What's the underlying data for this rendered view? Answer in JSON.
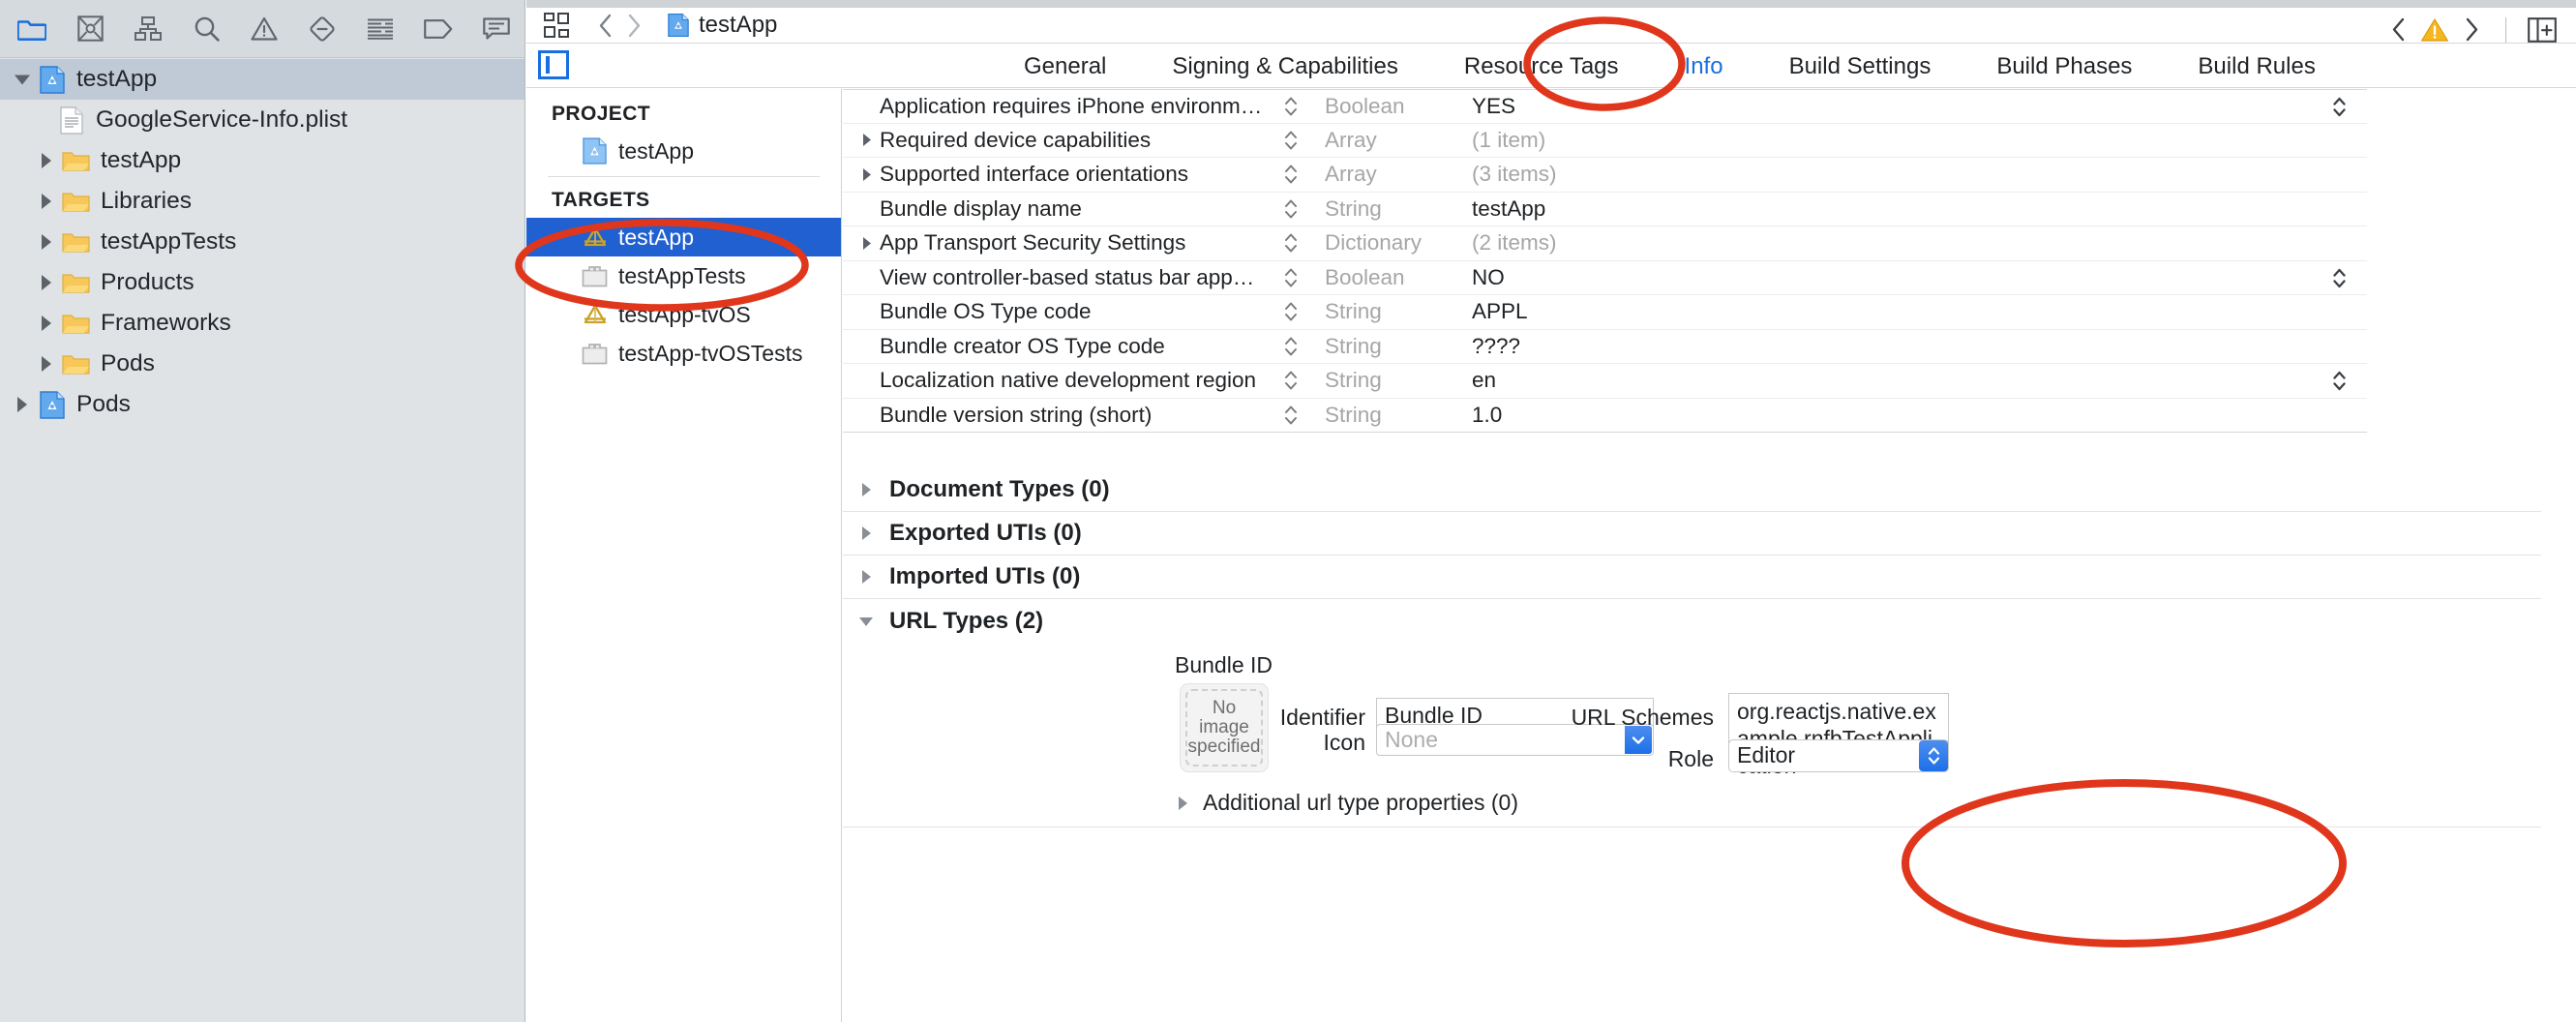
{
  "navigator": {
    "toolbar_icons": [
      {
        "name": "folder-icon",
        "label": "Project navigator",
        "active": true
      },
      {
        "name": "source-control-icon",
        "label": "Source control navigator",
        "active": false
      },
      {
        "name": "hierarchy-icon",
        "label": "Symbol navigator",
        "active": false
      },
      {
        "name": "search-icon",
        "label": "Find navigator",
        "active": false
      },
      {
        "name": "warning-triangle-icon",
        "label": "Issue navigator",
        "active": false
      },
      {
        "name": "test-diamond-icon",
        "label": "Test navigator",
        "active": false
      },
      {
        "name": "debug-list-icon",
        "label": "Debug navigator",
        "active": false
      },
      {
        "name": "breakpoint-tag-icon",
        "label": "Breakpoint navigator",
        "active": false
      },
      {
        "name": "report-bubble-icon",
        "label": "Report navigator",
        "active": false
      }
    ],
    "tree": [
      {
        "label": "testApp",
        "icon": "xcode-project-icon",
        "depth": 0,
        "twisty": "down",
        "selected": true
      },
      {
        "label": "GoogleService-Info.plist",
        "icon": "plist-file-icon",
        "depth": 1,
        "twisty": "none",
        "selected": false
      },
      {
        "label": "testApp",
        "icon": "folder-icon",
        "depth": 1,
        "twisty": "right",
        "selected": false
      },
      {
        "label": "Libraries",
        "icon": "folder-icon",
        "depth": 1,
        "twisty": "right",
        "selected": false
      },
      {
        "label": "testAppTests",
        "icon": "folder-icon",
        "depth": 1,
        "twisty": "right",
        "selected": false
      },
      {
        "label": "Products",
        "icon": "folder-icon",
        "depth": 1,
        "twisty": "right",
        "selected": false
      },
      {
        "label": "Frameworks",
        "icon": "folder-icon",
        "depth": 1,
        "twisty": "right",
        "selected": false
      },
      {
        "label": "Pods",
        "icon": "folder-icon",
        "depth": 1,
        "twisty": "right",
        "selected": false
      },
      {
        "label": "Pods",
        "icon": "xcode-project-icon",
        "depth": 0,
        "twisty": "right",
        "selected": false
      }
    ]
  },
  "editor_toolbar": {
    "breadcrumb_title": "testApp",
    "back_label": "‹",
    "forward_label": "›"
  },
  "tabs": [
    {
      "label": "General",
      "active": false
    },
    {
      "label": "Signing & Capabilities",
      "active": false
    },
    {
      "label": "Resource Tags",
      "active": false
    },
    {
      "label": "Info",
      "active": true
    },
    {
      "label": "Build Settings",
      "active": false
    },
    {
      "label": "Build Phases",
      "active": false
    },
    {
      "label": "Build Rules",
      "active": false
    }
  ],
  "project_panel": {
    "project_header": "PROJECT",
    "project_items": [
      {
        "label": "testApp",
        "icon": "xcode-project-icon",
        "selected": false
      }
    ],
    "targets_header": "TARGETS",
    "target_items": [
      {
        "label": "testApp",
        "icon": "app-target-icon",
        "selected": true
      },
      {
        "label": "testAppTests",
        "icon": "test-target-icon",
        "selected": false
      },
      {
        "label": "testApp-tvOS",
        "icon": "app-target-icon",
        "selected": false
      },
      {
        "label": "testApp-tvOSTests",
        "icon": "test-target-icon",
        "selected": false
      }
    ]
  },
  "info": {
    "plist_rows": [
      {
        "key": "Application requires iPhone environm…",
        "type": "Boolean",
        "value": "YES",
        "twisty": "none",
        "stepper_end": true
      },
      {
        "key": "Required device capabilities",
        "type": "Array",
        "value": "(1 item)",
        "twisty": "right",
        "value_dim": true,
        "stepper_end": false
      },
      {
        "key": "Supported interface orientations",
        "type": "Array",
        "value": "(3 items)",
        "twisty": "right",
        "value_dim": true,
        "stepper_end": false
      },
      {
        "key": "Bundle display name",
        "type": "String",
        "value": "testApp",
        "twisty": "none",
        "stepper_end": false
      },
      {
        "key": "App Transport Security Settings",
        "type": "Dictionary",
        "value": "(2 items)",
        "twisty": "right",
        "value_dim": true,
        "stepper_end": false
      },
      {
        "key": "View controller-based status bar app…",
        "type": "Boolean",
        "value": "NO",
        "twisty": "none",
        "stepper_end": true
      },
      {
        "key": "Bundle OS Type code",
        "type": "String",
        "value": "APPL",
        "twisty": "none",
        "stepper_end": false
      },
      {
        "key": "Bundle creator OS Type code",
        "type": "String",
        "value": "????",
        "twisty": "none",
        "stepper_end": false
      },
      {
        "key": "Localization native development region",
        "type": "String",
        "value": "en",
        "twisty": "none",
        "stepper_end": true
      },
      {
        "key": "Bundle version string (short)",
        "type": "String",
        "value": "1.0",
        "twisty": "none",
        "stepper_end": false
      }
    ],
    "sections": [
      {
        "label": "Document Types (0)",
        "expanded": false
      },
      {
        "label": "Exported UTIs (0)",
        "expanded": false
      },
      {
        "label": "Imported UTIs (0)",
        "expanded": false
      },
      {
        "label": "URL Types (2)",
        "expanded": true
      }
    ],
    "url_type": {
      "bundle_id_title": "Bundle ID",
      "no_image_text": "No\nimage\nspecified",
      "no_image_line1": "No",
      "no_image_line2": "image",
      "no_image_line3": "specified",
      "identifier_label": "Identifier",
      "identifier_value": "Bundle ID",
      "icon_label": "Icon",
      "icon_placeholder": "None",
      "url_schemes_label": "URL Schemes",
      "url_schemes_value": "org.reactjs.native.example.rnfbTestApplication",
      "role_label": "Role",
      "role_value": "Editor",
      "additional_props_label": "Additional url type properties (0)"
    }
  },
  "annotation": {
    "color": "#e0361c",
    "marks": [
      "targets-testapp-ellipse",
      "info-tab-ellipse",
      "url-schemes-ellipse"
    ]
  },
  "colors": {
    "accent_blue": "#1a6fe0",
    "selection_blue": "#2060d0",
    "nav_bg": "#dfe3e6",
    "nav_selection": "#bfcad6",
    "annotation_red": "#e0361c",
    "warning_yellow": "#f5b71d"
  }
}
